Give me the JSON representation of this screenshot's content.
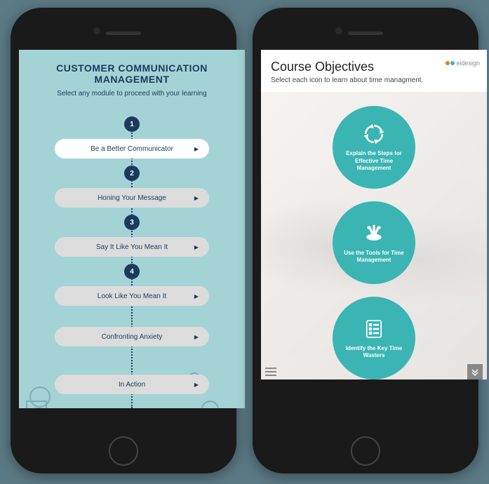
{
  "left": {
    "title": "CUSTOMER COMMUNICATION MANAGEMENT",
    "subtitle": "Select any module to proceed with your learning",
    "steps": [
      "1",
      "2",
      "3",
      "4"
    ],
    "modules": [
      {
        "label": "Be a Better Communicator",
        "active": true
      },
      {
        "label": "Honing Your Message",
        "active": false
      },
      {
        "label": "Say It Like You Mean It",
        "active": false
      },
      {
        "label": "Look Like You Mean It",
        "active": false
      },
      {
        "label": "Confronting Anxiety",
        "active": false
      },
      {
        "label": "In Action",
        "active": false
      }
    ]
  },
  "right": {
    "title": "Course Objectives",
    "subtitle": "Select each icon to learn about time managment.",
    "brand": "eidesign",
    "objectives": [
      {
        "icon": "cycle-icon",
        "text": "Explain the Steps for Effective Time Management"
      },
      {
        "icon": "tools-icon",
        "text": "Use the Tools for Time Management"
      },
      {
        "icon": "checklist-icon",
        "text": "Identify the Key Time Wasters"
      }
    ]
  },
  "colors": {
    "accent_left": "#1a3a5e",
    "accent_right": "#3bb4b4"
  }
}
